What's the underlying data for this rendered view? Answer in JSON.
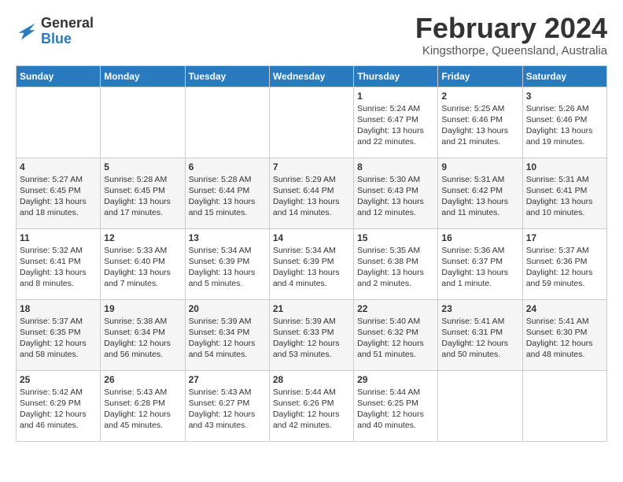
{
  "logo": {
    "general": "General",
    "blue": "Blue"
  },
  "title": "February 2024",
  "location": "Kingsthorpe, Queensland, Australia",
  "days_of_week": [
    "Sunday",
    "Monday",
    "Tuesday",
    "Wednesday",
    "Thursday",
    "Friday",
    "Saturday"
  ],
  "weeks": [
    [
      {
        "day": "",
        "info": ""
      },
      {
        "day": "",
        "info": ""
      },
      {
        "day": "",
        "info": ""
      },
      {
        "day": "",
        "info": ""
      },
      {
        "day": "1",
        "info": "Sunrise: 5:24 AM\nSunset: 6:47 PM\nDaylight: 13 hours\nand 22 minutes."
      },
      {
        "day": "2",
        "info": "Sunrise: 5:25 AM\nSunset: 6:46 PM\nDaylight: 13 hours\nand 21 minutes."
      },
      {
        "day": "3",
        "info": "Sunrise: 5:26 AM\nSunset: 6:46 PM\nDaylight: 13 hours\nand 19 minutes."
      }
    ],
    [
      {
        "day": "4",
        "info": "Sunrise: 5:27 AM\nSunset: 6:45 PM\nDaylight: 13 hours\nand 18 minutes."
      },
      {
        "day": "5",
        "info": "Sunrise: 5:28 AM\nSunset: 6:45 PM\nDaylight: 13 hours\nand 17 minutes."
      },
      {
        "day": "6",
        "info": "Sunrise: 5:28 AM\nSunset: 6:44 PM\nDaylight: 13 hours\nand 15 minutes."
      },
      {
        "day": "7",
        "info": "Sunrise: 5:29 AM\nSunset: 6:44 PM\nDaylight: 13 hours\nand 14 minutes."
      },
      {
        "day": "8",
        "info": "Sunrise: 5:30 AM\nSunset: 6:43 PM\nDaylight: 13 hours\nand 12 minutes."
      },
      {
        "day": "9",
        "info": "Sunrise: 5:31 AM\nSunset: 6:42 PM\nDaylight: 13 hours\nand 11 minutes."
      },
      {
        "day": "10",
        "info": "Sunrise: 5:31 AM\nSunset: 6:41 PM\nDaylight: 13 hours\nand 10 minutes."
      }
    ],
    [
      {
        "day": "11",
        "info": "Sunrise: 5:32 AM\nSunset: 6:41 PM\nDaylight: 13 hours\nand 8 minutes."
      },
      {
        "day": "12",
        "info": "Sunrise: 5:33 AM\nSunset: 6:40 PM\nDaylight: 13 hours\nand 7 minutes."
      },
      {
        "day": "13",
        "info": "Sunrise: 5:34 AM\nSunset: 6:39 PM\nDaylight: 13 hours\nand 5 minutes."
      },
      {
        "day": "14",
        "info": "Sunrise: 5:34 AM\nSunset: 6:39 PM\nDaylight: 13 hours\nand 4 minutes."
      },
      {
        "day": "15",
        "info": "Sunrise: 5:35 AM\nSunset: 6:38 PM\nDaylight: 13 hours\nand 2 minutes."
      },
      {
        "day": "16",
        "info": "Sunrise: 5:36 AM\nSunset: 6:37 PM\nDaylight: 13 hours\nand 1 minute."
      },
      {
        "day": "17",
        "info": "Sunrise: 5:37 AM\nSunset: 6:36 PM\nDaylight: 12 hours\nand 59 minutes."
      }
    ],
    [
      {
        "day": "18",
        "info": "Sunrise: 5:37 AM\nSunset: 6:35 PM\nDaylight: 12 hours\nand 58 minutes."
      },
      {
        "day": "19",
        "info": "Sunrise: 5:38 AM\nSunset: 6:34 PM\nDaylight: 12 hours\nand 56 minutes."
      },
      {
        "day": "20",
        "info": "Sunrise: 5:39 AM\nSunset: 6:34 PM\nDaylight: 12 hours\nand 54 minutes."
      },
      {
        "day": "21",
        "info": "Sunrise: 5:39 AM\nSunset: 6:33 PM\nDaylight: 12 hours\nand 53 minutes."
      },
      {
        "day": "22",
        "info": "Sunrise: 5:40 AM\nSunset: 6:32 PM\nDaylight: 12 hours\nand 51 minutes."
      },
      {
        "day": "23",
        "info": "Sunrise: 5:41 AM\nSunset: 6:31 PM\nDaylight: 12 hours\nand 50 minutes."
      },
      {
        "day": "24",
        "info": "Sunrise: 5:41 AM\nSunset: 6:30 PM\nDaylight: 12 hours\nand 48 minutes."
      }
    ],
    [
      {
        "day": "25",
        "info": "Sunrise: 5:42 AM\nSunset: 6:29 PM\nDaylight: 12 hours\nand 46 minutes."
      },
      {
        "day": "26",
        "info": "Sunrise: 5:43 AM\nSunset: 6:28 PM\nDaylight: 12 hours\nand 45 minutes."
      },
      {
        "day": "27",
        "info": "Sunrise: 5:43 AM\nSunset: 6:27 PM\nDaylight: 12 hours\nand 43 minutes."
      },
      {
        "day": "28",
        "info": "Sunrise: 5:44 AM\nSunset: 6:26 PM\nDaylight: 12 hours\nand 42 minutes."
      },
      {
        "day": "29",
        "info": "Sunrise: 5:44 AM\nSunset: 6:25 PM\nDaylight: 12 hours\nand 40 minutes."
      },
      {
        "day": "",
        "info": ""
      },
      {
        "day": "",
        "info": ""
      }
    ]
  ]
}
